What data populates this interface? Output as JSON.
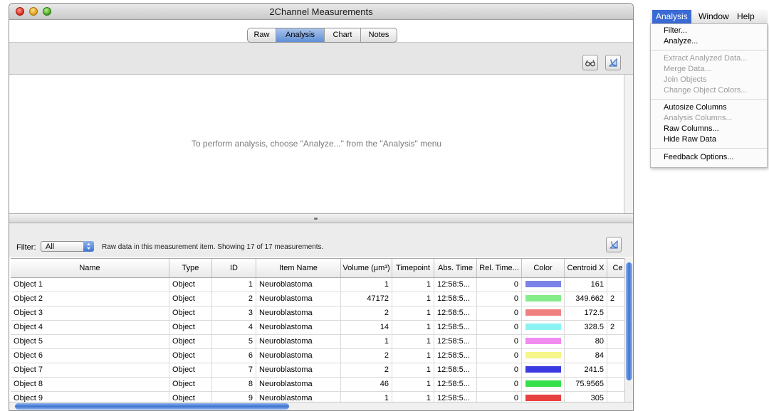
{
  "window": {
    "title": "2Channel Measurements",
    "tabs": [
      {
        "label": "Raw",
        "active": false
      },
      {
        "label": "Analysis",
        "active": true
      },
      {
        "label": "Chart",
        "active": false
      },
      {
        "label": "Notes",
        "active": false
      }
    ]
  },
  "analysis": {
    "placeholder": "To perform analysis, choose \"Analyze...\" from the \"Analysis\" menu"
  },
  "filter": {
    "label": "Filter:",
    "value": "All",
    "status": "Raw data in this measurement item.  Showing 17 of 17 measurements."
  },
  "table": {
    "columns": [
      "Name",
      "Type",
      "ID",
      "Item Name",
      "Volume (µm³)",
      "Timepoint",
      "Abs. Time",
      "Rel. Time...",
      "Color",
      "Centroid X",
      "Ce"
    ],
    "rows": [
      {
        "name": "Object 1",
        "type": "Object",
        "id": "1",
        "item": "Neuroblastoma",
        "volume": "1",
        "timepoint": "1",
        "abs": "12:58:5...",
        "rel": "0",
        "color": "#7b83e8",
        "cx": "161",
        "extra": ""
      },
      {
        "name": "Object 2",
        "type": "Object",
        "id": "2",
        "item": "Neuroblastoma",
        "volume": "47172",
        "timepoint": "1",
        "abs": "12:58:5...",
        "rel": "0",
        "color": "#86ec8a",
        "cx": "349.662",
        "extra": "2"
      },
      {
        "name": "Object 3",
        "type": "Object",
        "id": "3",
        "item": "Neuroblastoma",
        "volume": "2",
        "timepoint": "1",
        "abs": "12:58:5...",
        "rel": "0",
        "color": "#f08080",
        "cx": "172.5",
        "extra": ""
      },
      {
        "name": "Object 4",
        "type": "Object",
        "id": "4",
        "item": "Neuroblastoma",
        "volume": "14",
        "timepoint": "1",
        "abs": "12:58:5...",
        "rel": "0",
        "color": "#8cf3f3",
        "cx": "328.5",
        "extra": "2"
      },
      {
        "name": "Object 5",
        "type": "Object",
        "id": "5",
        "item": "Neuroblastoma",
        "volume": "1",
        "timepoint": "1",
        "abs": "12:58:5...",
        "rel": "0",
        "color": "#f08cf0",
        "cx": "80",
        "extra": ""
      },
      {
        "name": "Object 6",
        "type": "Object",
        "id": "6",
        "item": "Neuroblastoma",
        "volume": "2",
        "timepoint": "1",
        "abs": "12:58:5...",
        "rel": "0",
        "color": "#f6f68a",
        "cx": "84",
        "extra": ""
      },
      {
        "name": "Object 7",
        "type": "Object",
        "id": "7",
        "item": "Neuroblastoma",
        "volume": "2",
        "timepoint": "1",
        "abs": "12:58:5...",
        "rel": "0",
        "color": "#3a3ae0",
        "cx": "241.5",
        "extra": ""
      },
      {
        "name": "Object 8",
        "type": "Object",
        "id": "8",
        "item": "Neuroblastoma",
        "volume": "46",
        "timepoint": "1",
        "abs": "12:58:5...",
        "rel": "0",
        "color": "#36e04a",
        "cx": "75.9565",
        "extra": ""
      },
      {
        "name": "Object 9",
        "type": "Object",
        "id": "9",
        "item": "Neuroblastoma",
        "volume": "1",
        "timepoint": "1",
        "abs": "12:58:5...",
        "rel": "0",
        "color": "#e84040",
        "cx": "305",
        "extra": ""
      }
    ]
  },
  "menubar": {
    "items": [
      "Analysis",
      "Window",
      "Help"
    ]
  },
  "menu": {
    "items": [
      {
        "label": "Filter...",
        "enabled": true
      },
      {
        "label": "Analyze...",
        "enabled": true
      },
      {
        "label": "Extract Analyzed Data...",
        "enabled": false
      },
      {
        "label": "Merge Data...",
        "enabled": false
      },
      {
        "label": "Join Objects",
        "enabled": false
      },
      {
        "label": "Change Object Colors...",
        "enabled": false
      },
      {
        "label": "Autosize Columns",
        "enabled": true
      },
      {
        "label": "Analysis Columns...",
        "enabled": false
      },
      {
        "label": "Raw Columns...",
        "enabled": true
      },
      {
        "label": "Hide Raw Data",
        "enabled": true
      },
      {
        "label": "Feedback Options...",
        "enabled": true
      }
    ]
  },
  "icons": {
    "toolbar": [
      "glasses-icon",
      "export-icon"
    ],
    "filterbar": [
      "export-icon"
    ]
  },
  "colors": {
    "selection": "#3a6ad4",
    "scroll_thumb": "#3e74d0"
  }
}
